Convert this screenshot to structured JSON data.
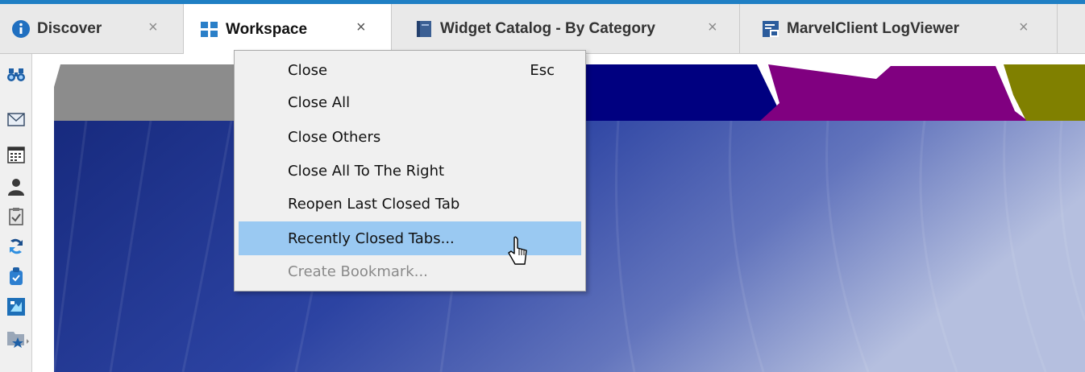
{
  "tabs": [
    {
      "label": "Discover",
      "icon": "info-icon",
      "active": false
    },
    {
      "label": "Workspace",
      "icon": "workspace-grid-icon",
      "active": true
    },
    {
      "label": "Widget Catalog - By Category",
      "icon": "catalog-icon",
      "active": false
    },
    {
      "label": "MarvelClient LogViewer",
      "icon": "logviewer-icon",
      "active": false
    }
  ],
  "tab_close_glyph": "×",
  "sidebar": {
    "icons": [
      "binoculars-icon",
      "mail-icon",
      "calendar-icon",
      "contacts-icon",
      "todo-icon",
      "replication-icon",
      "security-icon",
      "workspace-icon",
      "favorites-folder-icon"
    ]
  },
  "context_menu": {
    "items": [
      {
        "label": "Close",
        "shortcut": "Esc",
        "state": "normal"
      },
      {
        "label": "Close All",
        "shortcut": "",
        "state": "normal"
      },
      {
        "label": "Close Others",
        "shortcut": "",
        "state": "normal"
      },
      {
        "label": "Close All To The Right",
        "shortcut": "",
        "state": "normal"
      },
      {
        "label": "Reopen Last Closed Tab",
        "shortcut": "",
        "state": "normal"
      },
      {
        "label": "Recently Closed Tabs...",
        "shortcut": "",
        "state": "hover"
      },
      {
        "label": "Create Bookmark...",
        "shortcut": "",
        "state": "disabled"
      }
    ]
  },
  "colors": {
    "accent": "#1f7fc4",
    "menu_hover": "#9ac9f2",
    "workspace_bg_dark": "#1c2f8a",
    "workspace_bg_light": "#a8b4d8",
    "tab_gray": "#8c8c8c",
    "tab_navy": "#000080",
    "tab_purple": "#800080",
    "tab_olive": "#808000"
  }
}
